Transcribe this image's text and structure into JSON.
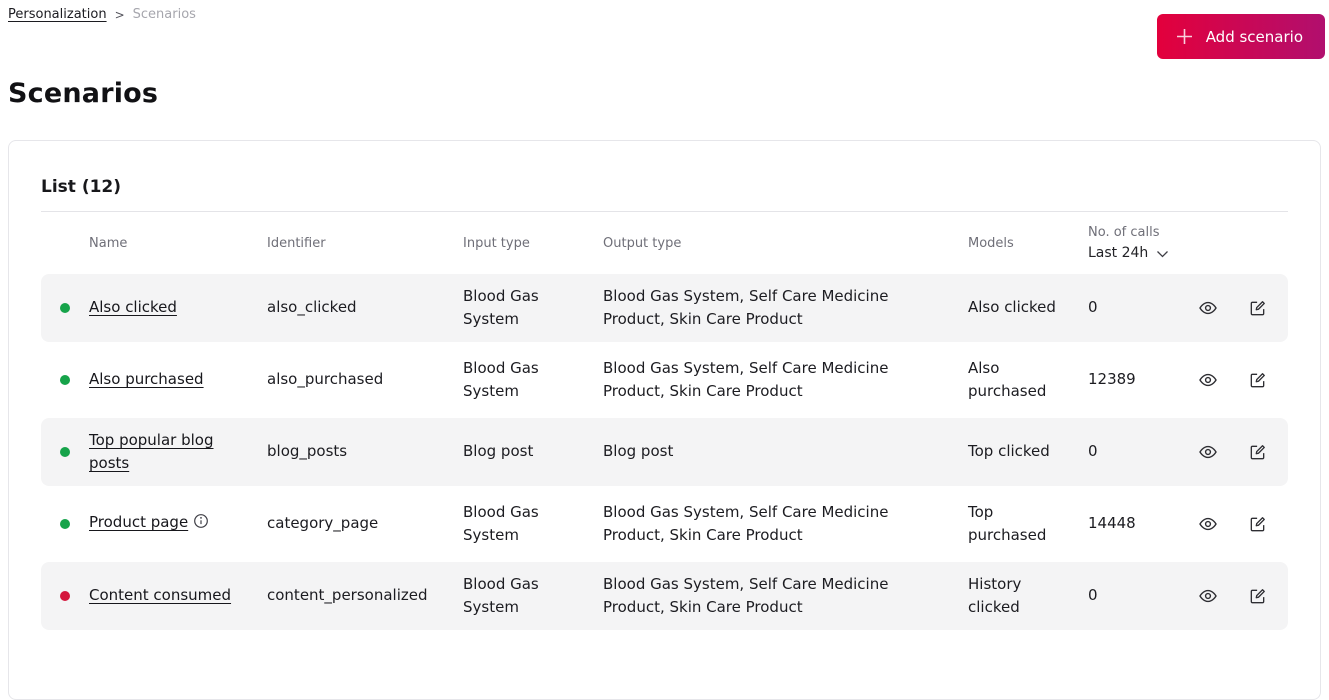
{
  "page": {
    "breadcrumb": {
      "parent": "Personalization",
      "separator": ">",
      "current": "Scenarios"
    },
    "title": "Scenarios",
    "add_scenario_label": "Add scenario"
  },
  "list": {
    "title": "List (12)",
    "columns": {
      "name": "Name",
      "identifier": "Identifier",
      "input_type": "Input type",
      "output_type": "Output type",
      "models": "Models",
      "calls": "No. of calls",
      "calls_filter": "Last 24h"
    },
    "rows": [
      {
        "status": "active",
        "status_color": "#16a34a",
        "name": "Also clicked",
        "identifier": "also_clicked",
        "input_type": "Blood Gas System",
        "output_type": "Blood Gas System, Self Care Medicine Product, Skin Care Product",
        "models": "Also clicked",
        "calls": "0",
        "has_info": false
      },
      {
        "status": "active",
        "status_color": "#16a34a",
        "name": "Also purchased",
        "identifier": "also_purchased",
        "input_type": "Blood Gas System",
        "output_type": "Blood Gas System, Self Care Medicine Product, Skin Care Product",
        "models": "Also purchased",
        "calls": "12389",
        "has_info": false
      },
      {
        "status": "active",
        "status_color": "#16a34a",
        "name": "Top popular blog posts",
        "identifier": "blog_posts",
        "input_type": "Blog post",
        "output_type": "Blog post",
        "models": "Top clicked",
        "calls": "0",
        "has_info": false
      },
      {
        "status": "active",
        "status_color": "#16a34a",
        "name": "Product page",
        "identifier": "category_page",
        "input_type": "Blood Gas System",
        "output_type": "Blood Gas System, Self Care Medicine Product, Skin Care Product",
        "models": "Top purchased",
        "calls": "14448",
        "has_info": true
      },
      {
        "status": "inactive",
        "status_color": "#d4163c",
        "name": "Content consumed",
        "identifier": "content_personalized",
        "input_type": "Blood Gas System",
        "output_type": "Blood Gas System, Self Care Medicine Product, Skin Care Product",
        "models": "History clicked",
        "calls": "0",
        "has_info": false
      }
    ]
  },
  "colors": {
    "accent_gradient_start": "#e3003c",
    "accent_gradient_end": "#b10f6e",
    "status_active": "#16a34a",
    "status_inactive": "#d4163c",
    "row_stripe": "#f4f4f5"
  }
}
